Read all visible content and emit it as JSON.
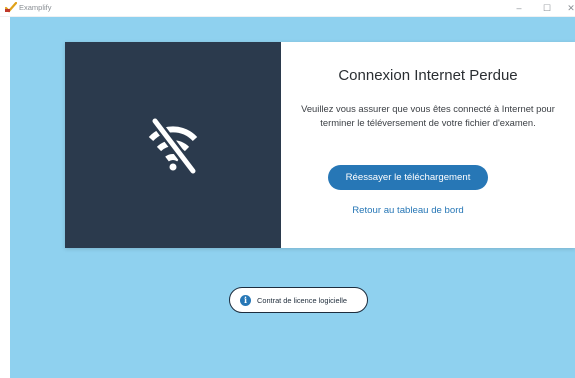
{
  "window": {
    "app_name": "Examplify",
    "controls": {
      "minimize": "–",
      "maximize": "☐",
      "close": "✕"
    }
  },
  "dialog": {
    "icon": "wifi-off-icon",
    "title": "Connexion Internet Perdue",
    "message": "Veuillez vous assurer que vous êtes connecté à Internet pour terminer le téléversement de votre fichier d'examen.",
    "retry_label": "Réessayer le téléchargement",
    "dashboard_label": "Retour au tableau de bord"
  },
  "footer": {
    "license_icon": "info-icon",
    "license_icon_glyph": "i",
    "license_label": "Contrat de licence logicielle"
  },
  "colors": {
    "background": "#8fd1ef",
    "panel_dark": "#2b3a4d",
    "accent": "#2777b6"
  }
}
